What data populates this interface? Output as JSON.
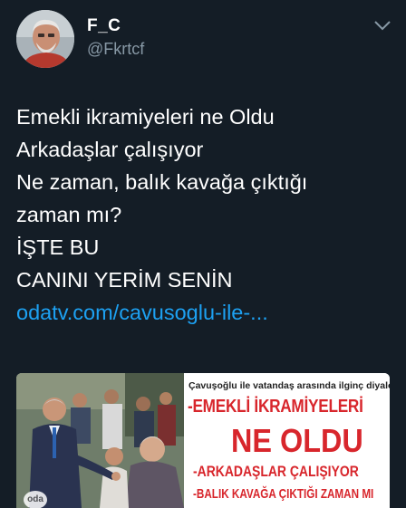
{
  "user": {
    "display_name": "F_C",
    "handle": "@Fkrtcf"
  },
  "tweet": {
    "lines": [
      "Emekli ikramiyeleri ne Oldu",
      "Arkadaşlar çalışıyor",
      "Ne zaman, balık kavağa çıktığı",
      "zaman mı?",
      "İŞTE BU",
      "CANINI YERİM SENİN"
    ],
    "link": "odatv.com/cavusoglu-ile-..."
  },
  "media": {
    "caption": "Çavuşoğlu ile vatandaş arasında ilginç diyalog",
    "headline_1": "-EMEKLİ İKRAMİYELERİ",
    "headline_2": "NE OLDU",
    "headline_3": "-ARKADAŞLAR ÇALIŞIYOR",
    "headline_4": "-BALIK KAVAĞA ÇIKTIĞI ZAMAN MI",
    "watermark": "oda"
  },
  "colors": {
    "background": "#141d26",
    "text": "#ffffff",
    "secondary": "#8899a6",
    "link": "#1da1f2",
    "headline_red": "#d8262c"
  },
  "icons": {
    "menu": "chevron-down-icon",
    "avatar": "user-avatar"
  }
}
